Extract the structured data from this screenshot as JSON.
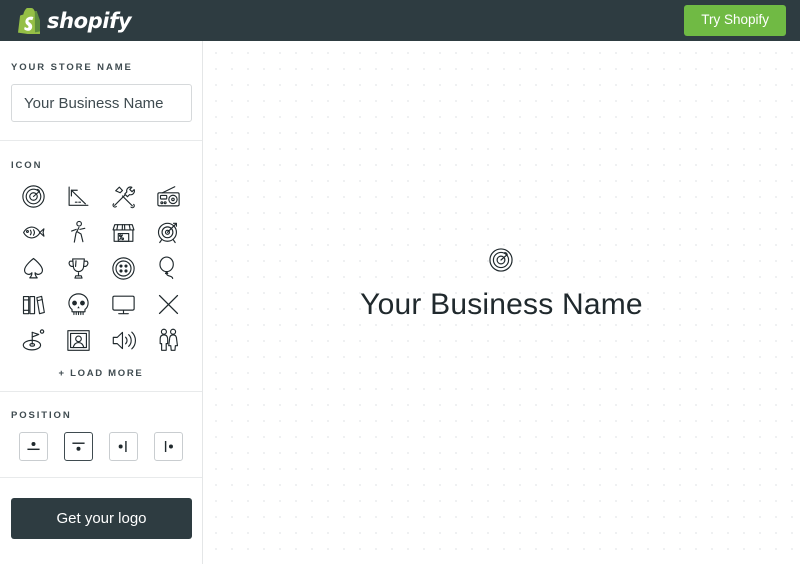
{
  "header": {
    "brand_name": "shopify",
    "brand_icon": "shopify-bag-icon",
    "try_button_label": "Try Shopify",
    "accent_green": "#70ba44",
    "bar_color": "#2e3c41"
  },
  "sidebar": {
    "store": {
      "label": "YOUR STORE NAME",
      "value": "Your Business Name",
      "placeholder": "Your Business Name"
    },
    "icons": {
      "label": "ICON",
      "load_more_label": "+ LOAD MORE",
      "selected_index": 0,
      "items": [
        {
          "name": "radar-icon"
        },
        {
          "name": "declining-chart-icon"
        },
        {
          "name": "tools-hammer-wrench-icon"
        },
        {
          "name": "radio-icon"
        },
        {
          "name": "fish-icon"
        },
        {
          "name": "walking-person-icon"
        },
        {
          "name": "storefront-icon"
        },
        {
          "name": "target-arrow-icon"
        },
        {
          "name": "spade-icon"
        },
        {
          "name": "trophy-icon"
        },
        {
          "name": "sewing-button-icon"
        },
        {
          "name": "balloon-icon"
        },
        {
          "name": "books-icon"
        },
        {
          "name": "skull-icon"
        },
        {
          "name": "monitor-icon"
        },
        {
          "name": "x-cross-icon"
        },
        {
          "name": "golf-flag-icon"
        },
        {
          "name": "portrait-frame-icon"
        },
        {
          "name": "speaker-volume-icon"
        },
        {
          "name": "couple-people-icon"
        }
      ]
    },
    "position": {
      "label": "POSITION",
      "selected_index": 1,
      "options": [
        {
          "name": "icon-above-text"
        },
        {
          "name": "icon-below-text"
        },
        {
          "name": "icon-left-of-text"
        },
        {
          "name": "icon-right-of-text"
        }
      ]
    },
    "cta_label": "Get your logo"
  },
  "canvas": {
    "logo_icon": "radar-icon",
    "logo_text": "Your Business Name"
  }
}
